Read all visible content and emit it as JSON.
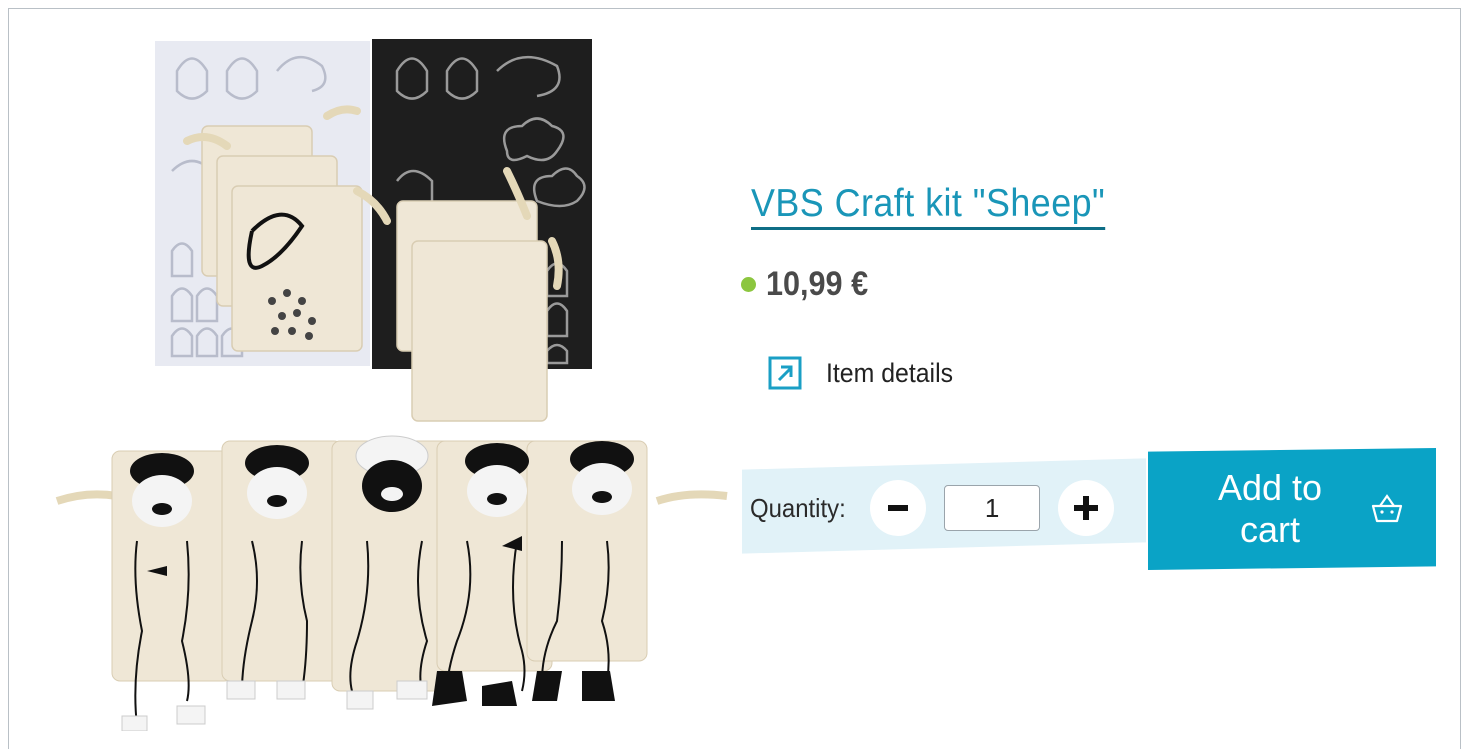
{
  "product": {
    "title": "VBS Craft kit \"Sheep\"",
    "price": "10,99 €",
    "availability_color": "#8cc63f",
    "image_icon": "sheep-craft-kit-photo"
  },
  "details": {
    "label": "Item details",
    "icon": "external-link-icon"
  },
  "quantity": {
    "label": "Quantity:",
    "value": "1",
    "decrement_icon": "minus-icon",
    "increment_icon": "plus-icon"
  },
  "cart": {
    "label": "Add to cart",
    "icon": "basket-icon",
    "color": "#0aa3c6"
  },
  "colors": {
    "accent": "#1a96b8",
    "panel": "#e1f2f8"
  }
}
